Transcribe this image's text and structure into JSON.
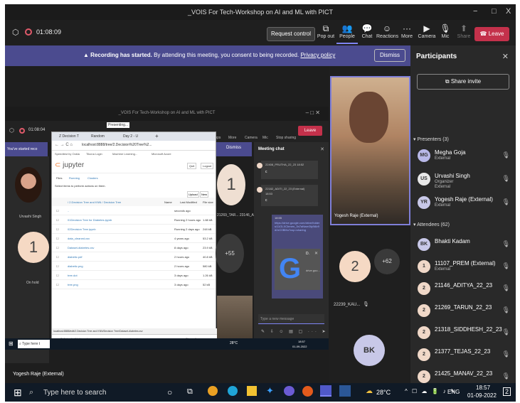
{
  "window": {
    "title": "_VOIS For Tech-Workshop on AI and ML with PICT",
    "min": "−",
    "max": "□",
    "close": "X"
  },
  "toolbar": {
    "timer": "01:08:09",
    "request_control": "Request control",
    "buttons": [
      "Pop out",
      "People",
      "Chat",
      "Reactions",
      "More",
      "Camera",
      "Mic",
      "Share"
    ],
    "leave": "Leave"
  },
  "banner": {
    "strong": "Recording has started.",
    "text": "By attending this meeting, you consent to being recorded.",
    "link": "Privacy policy",
    "dismiss": "Dismiss"
  },
  "participants": {
    "title": "Participants",
    "share_invite": "Share invite",
    "presenters_label": "Presenters (3)",
    "presenters": [
      {
        "initials": "MG",
        "name": "Megha Goja",
        "sub": "External",
        "color": "#b8b8e8"
      },
      {
        "initials": "US",
        "name": "Urvashi Singh",
        "sub": "Organizer",
        "sub2": "External",
        "color": "#e8e8e8"
      },
      {
        "initials": "YR",
        "name": "Yogesh Raje (External)",
        "sub": "External",
        "color": "#c8c8e8"
      }
    ],
    "attendees_label": "Attendees (62)",
    "attendees": [
      {
        "initials": "BK",
        "name": "Bhakti Kadam",
        "sub": "",
        "color": "#c8c8e8"
      },
      {
        "initials": "1",
        "name": "11107_PREM (External)",
        "sub": "External",
        "color": "#f0d8c8"
      },
      {
        "initials": "2",
        "name": "21146_ADITYA_22_23",
        "sub": "",
        "color": "#f0d8c8"
      },
      {
        "initials": "2",
        "name": "21269_TARUN_22_23",
        "sub": "",
        "color": "#f0d8c8"
      },
      {
        "initials": "2",
        "name": "21318_SIDDHESH_22_23",
        "sub": "",
        "color": "#f0d8c8"
      },
      {
        "initials": "2",
        "name": "21377_TEJAS_22_23",
        "sub": "",
        "color": "#f0d8c8"
      },
      {
        "initials": "2",
        "name": "21425_MANAV_22_23",
        "sub": "",
        "color": "#f0d8c8"
      }
    ]
  },
  "stage": {
    "inner_title": "_VOIS For Tech-Workshop on AI and ML with PICT",
    "inner_timer": "01:08:04",
    "presenting": "Presenting...",
    "started": "You've started reco",
    "inner_dismiss": "Dismiss",
    "inner_leave": "Leave",
    "inner_labels": [
      "Apps",
      "More",
      "Camera",
      "Mic",
      "Stop sharing"
    ],
    "speaker_name": "Yogesh Raje (External)",
    "urvashi_label": "Urvashi Singh",
    "tile_1": "1",
    "on_hold": "On hold",
    "tile_plus55": "+55",
    "tile_inner_1": "1",
    "inner_names": "21269_TAR... 23146_Aryu...",
    "tile_2": "2",
    "tile_2_label": "22239_KAU...",
    "tile_plus62": "+62",
    "bk": "BK",
    "presenter_footer": "Yogesh Raje (External)"
  },
  "chat": {
    "title": "Meeting chat",
    "m1_name": "22408_PRUTHA_22_23",
    "m1_time": "18:52",
    "m1_text": "c",
    "m2_name": "22182_ADITI_22_23 (External)",
    "m2_time": "18:53",
    "m2_text": "c",
    "link_time": "18:55",
    "link_text": "https://drive.google.com/drive/folders/11GLXCbmen_3n7aNwm3ly9Ab9d2zC0BMu?usp=sharing",
    "g_label": "D.",
    "g_site": "drive.goo...",
    "input_placeholder": "Type a new message"
  },
  "browser": {
    "tabs": [
      "Z Decision T",
      "Random",
      "Day 2 - U"
    ],
    "url": "localhost:8888/tree/2.Decision%20Tree%2...",
    "bookmarks": [
      "Speedtest by Ookla",
      "Tikona Login",
      "Machine Learning...",
      "Microsoft Azure"
    ],
    "jupyter": "jupyter",
    "quit": "Quit",
    "logout": "Logout",
    "nav_tabs": [
      "Files",
      "Running",
      "Clusters"
    ],
    "select_text": "Select items to perform actions on them.",
    "upload": "Upload",
    "new": "New",
    "breadcrumb": "/ 2.Decision Tree and KNN / Decision Tree",
    "cols": [
      "Name",
      "Last Modified",
      "File size"
    ],
    "rows": [
      {
        "name": "..",
        "mod": "seconds ago",
        "size": ""
      },
      {
        "name": "01Decision Tree for Diabetes.ipynb",
        "mod": "Running 2 hours ago",
        "size": "1.88 kB"
      },
      {
        "name": "02Decision Tree.ipynb",
        "mod": "Running 2 days ago",
        "size": "248 kB"
      },
      {
        "name": "data_cleaned.csv",
        "mod": "4 years ago",
        "size": "53.2 kB"
      },
      {
        "name": "Dataset-diabetes.csv",
        "mod": "8 days ago",
        "size": "23.9 kB"
      },
      {
        "name": "diabetic.pdf",
        "mod": "2 hours ago",
        "size": "40.8 kB"
      },
      {
        "name": "diabetic.png",
        "mod": "2 hours ago",
        "size": "580 kB"
      },
      {
        "name": "tree.dot",
        "mod": "3 days ago",
        "size": "1.26 kB"
      },
      {
        "name": "tree.png",
        "mod": "3 days ago",
        "size": "52 kB"
      }
    ],
    "status": "localhost:8888/edit/2.Decision Tree and KNN/Decision Tree/Dataset-diabetes.csv",
    "downloads": [
      "SyllabusforWebin....docx",
      "rain sensing mod....pptx"
    ],
    "show_all": "Show all"
  },
  "inner_taskbar": {
    "search": "Type here t",
    "temp": "28°C",
    "time": "18:57",
    "date": "01-09-2022"
  },
  "taskbar": {
    "search": "Type here to search",
    "temp": "28°C",
    "lang": "ENG",
    "time": "18:57",
    "date": "01-09-2022",
    "notif": "2"
  }
}
